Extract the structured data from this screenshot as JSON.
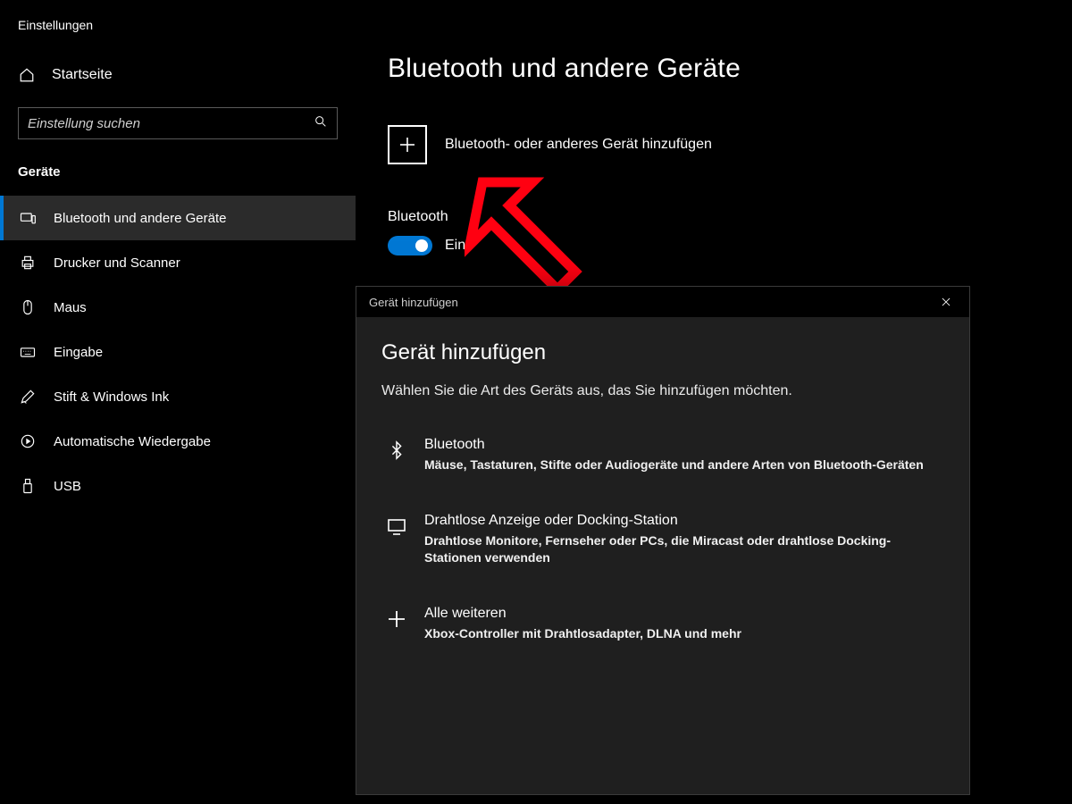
{
  "app_title": "Einstellungen",
  "home_label": "Startseite",
  "search_placeholder": "Einstellung suchen",
  "section_title": "Geräte",
  "nav": [
    {
      "label": "Bluetooth und andere Geräte",
      "icon": "bluetooth-pc-icon",
      "selected": true
    },
    {
      "label": "Drucker und Scanner",
      "icon": "printer-icon",
      "selected": false
    },
    {
      "label": "Maus",
      "icon": "mouse-icon",
      "selected": false
    },
    {
      "label": "Eingabe",
      "icon": "keyboard-icon",
      "selected": false
    },
    {
      "label": "Stift & Windows Ink",
      "icon": "pen-icon",
      "selected": false
    },
    {
      "label": "Automatische Wiedergabe",
      "icon": "autoplay-icon",
      "selected": false
    },
    {
      "label": "USB",
      "icon": "usb-icon",
      "selected": false
    }
  ],
  "page_title": "Bluetooth und andere Geräte",
  "add_device_label": "Bluetooth- oder anderes Gerät hinzufügen",
  "bluetooth": {
    "label": "Bluetooth",
    "state": "Ein",
    "on": true
  },
  "annotation": {
    "arrow_color": "#ff0011"
  },
  "dialog": {
    "titlebar": "Gerät hinzufügen",
    "heading": "Gerät hinzufügen",
    "subheading": "Wählen Sie die Art des Geräts aus, das Sie hinzufügen möchten.",
    "options": [
      {
        "title": "Bluetooth",
        "desc": "Mäuse, Tastaturen, Stifte oder Audiogeräte und andere Arten von Bluetooth-Geräten",
        "icon": "bluetooth-icon"
      },
      {
        "title": "Drahtlose Anzeige oder Docking-Station",
        "desc": "Drahtlose Monitore, Fernseher oder PCs, die Miracast oder drahtlose Docking-Stationen verwenden",
        "icon": "display-icon"
      },
      {
        "title": "Alle weiteren",
        "desc": "Xbox-Controller mit Drahtlosadapter, DLNA und mehr",
        "icon": "plus-icon"
      }
    ]
  }
}
